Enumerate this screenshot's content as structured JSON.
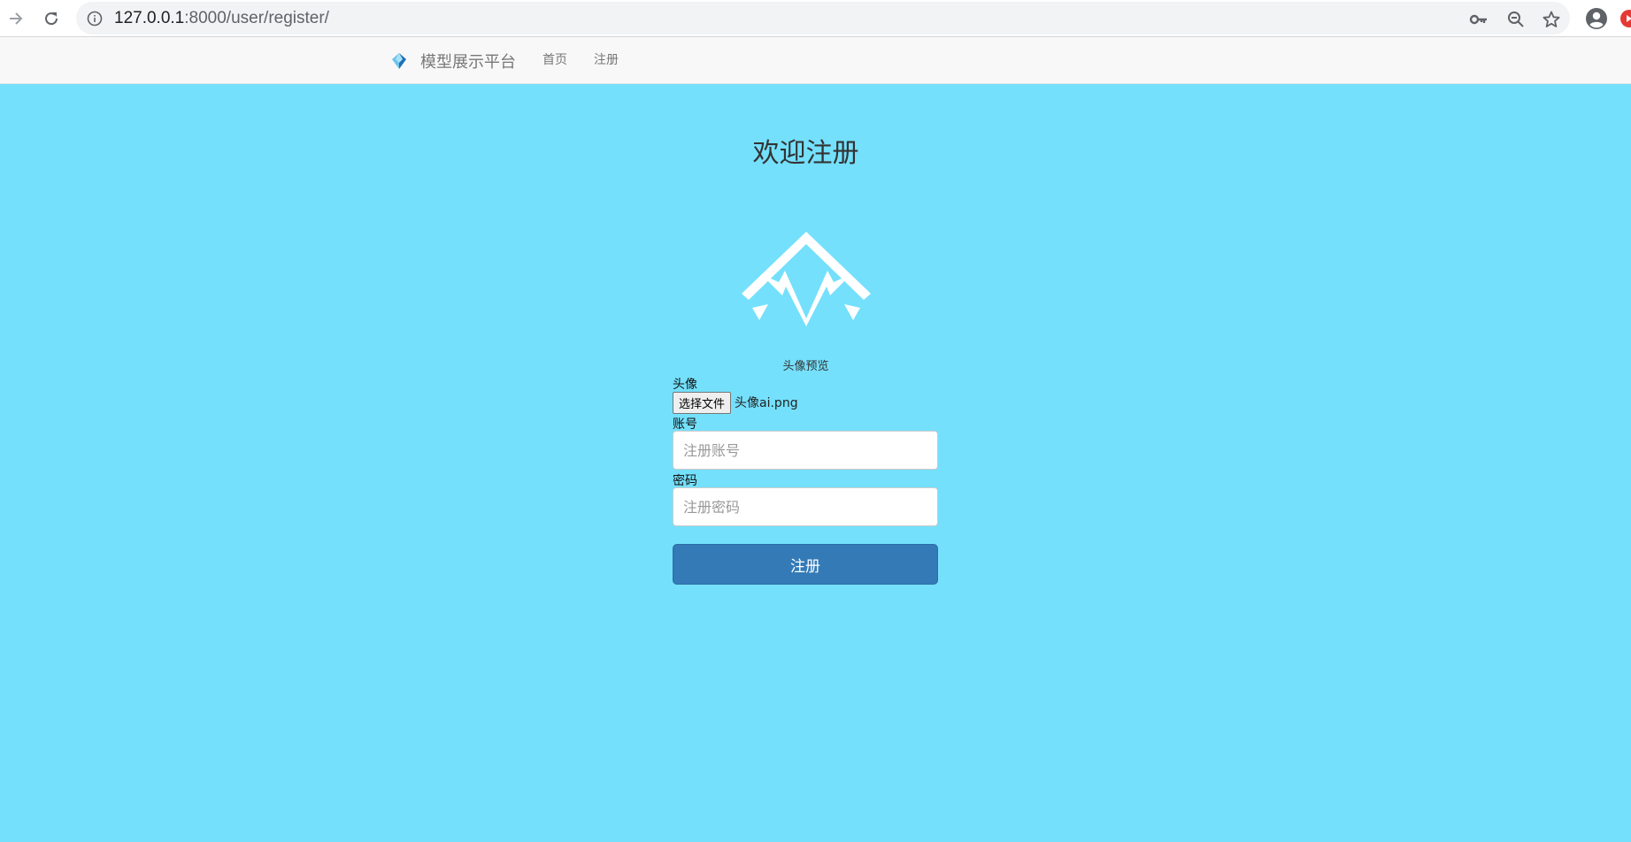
{
  "browser": {
    "url_host": "127.0.0.1",
    "url_rest": ":8000/user/register/"
  },
  "navbar": {
    "brand": "模型展示平台",
    "links": [
      "首页",
      "注册"
    ]
  },
  "form": {
    "title": "欢迎注册",
    "avatar_preview_label": "头像预览",
    "avatar_label": "头像",
    "file_button_label": "选择文件",
    "file_name": "头像ai.png",
    "account_label": "账号",
    "account_placeholder": "注册账号",
    "password_label": "密码",
    "password_placeholder": "注册密码",
    "submit_label": "注册"
  },
  "colors": {
    "page_background": "#74e0fc",
    "submit_button": "#337ab7"
  }
}
